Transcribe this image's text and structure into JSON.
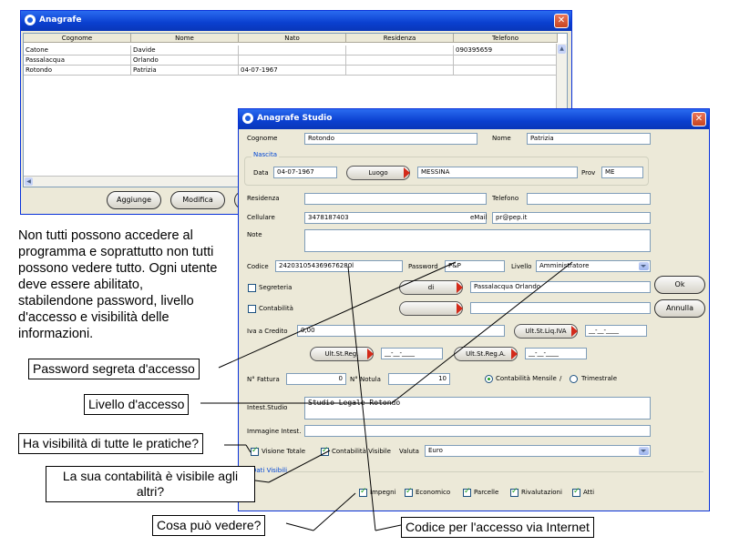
{
  "win1": {
    "title": "Anagrafe",
    "columns": [
      "Cognome",
      "Nome",
      "Nato",
      "Residenza",
      "Telefono"
    ],
    "rows": [
      [
        "Catone",
        "Davide",
        "",
        "",
        "090395659"
      ],
      [
        "Passalacqua",
        "Orlando",
        "",
        "",
        ""
      ],
      [
        "Rotondo",
        "Patrizia",
        "04-07-1967",
        "",
        ""
      ]
    ],
    "btn_add": "Aggiunge",
    "btn_edit": "Modifica"
  },
  "win2": {
    "title": "Anagrafe Studio",
    "cognome_label": "Cognome",
    "cognome": "Rotondo",
    "nome_label": "Nome",
    "nome": "Patrizia",
    "nascita_label": "Nascita",
    "data_label": "Data",
    "data": "04-07-1967",
    "luogo_btn": "Luogo",
    "luogo": "MESSINA",
    "prov_label": "Prov",
    "prov": "ME",
    "residenza_label": "Residenza",
    "residenza": "",
    "telefono_label": "Telefono",
    "telefono": "",
    "cellulare_label": "Cellulare",
    "cellulare": "3478187403",
    "email_label": "eMail",
    "email": "pr@pep.it",
    "note_label": "Note",
    "note": "",
    "codice_label": "Codice",
    "codice": "242031054369676280l",
    "password_label": "Password",
    "password": "P&P",
    "livello_label": "Livello",
    "livello": "Amministratore",
    "segreteria_label": "Segreteria",
    "di_btn": "di",
    "segreteria_value": "Passalacqua Orlando",
    "contabilita_label": "Contabilità",
    "contabilita_value": "",
    "ok_btn": "Ok",
    "annulla_btn": "Annulla",
    "iva_label": "Iva a Credito",
    "iva": "0,00",
    "ult_liq_btn": "Ult.St.Liq.IVA",
    "ult_liq_date": "__-__-____",
    "ult_reg_btn": "Ult.St.Reg.",
    "ult_reg_date": "__-__-____",
    "ult_rega_btn": "Ult.St.Reg.A.",
    "ult_rega_date": "__-__-____",
    "nfattura_label": "N° Fattura",
    "nfattura": "0",
    "nnotula_label": "N° Notula",
    "nnotula": "10",
    "cont_mensile": "Contabilità Mensile",
    "slash": "/",
    "trimestrale": "Trimestrale",
    "intest_label": "Intest.Studio",
    "intest": "Studio Legale Rotondo",
    "immagine_label": "Immagine Intest.",
    "immagine": "",
    "visione_totale": "Visione Totale",
    "contabilita_visibile": "Contabilità Visibile",
    "valuta_label": "Valuta",
    "valuta": "Euro",
    "dati_visibili": "Dati Visibili",
    "impegni": "Impegni",
    "economico": "Economico",
    "parcelle": "Parcelle",
    "rivalutazioni": "Rivalutazioni",
    "atti": "Atti"
  },
  "description": "Non tutti possono accedere al programma e soprattutto non tutti possono vedere tutto. Ogni utente deve essere abilitato, stabilendone password, livello d'accesso e visibilità delle informazioni.",
  "callouts": {
    "password": "Password segreta d'accesso",
    "livello": "Livello d'accesso",
    "visibilita": "Ha visibilità di tutte le pratiche?",
    "contabilita": "La sua contabilità è visibile agli altri?",
    "cosa": "Cosa può vedere?",
    "codice": "Codice per l'accesso via Internet"
  }
}
